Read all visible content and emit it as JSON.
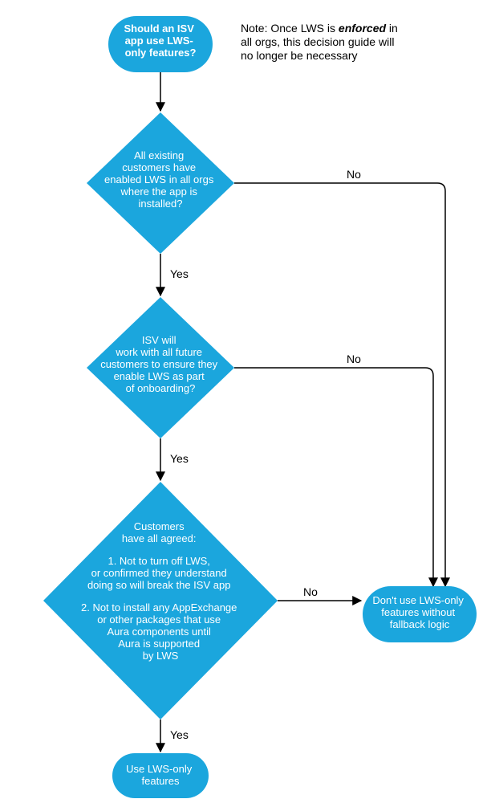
{
  "colors": {
    "shape": "#1ba6dd",
    "text_shape": "#ffffff",
    "text_note": "#000000",
    "edge": "#000000"
  },
  "start": {
    "text": "Should an ISV app use LWS-only features?"
  },
  "note": {
    "line1": "Note: Once LWS is",
    "emph": "enforced",
    "line1b": "in",
    "line2": "all orgs, this decision guide will",
    "line3": "no longer be necessary"
  },
  "decision1": {
    "text": "All existing customers have enabled LWS in all orgs where the app is installed?"
  },
  "decision2": {
    "text": "ISV will work with all future customers to ensure they enable LWS as part of onboarding?"
  },
  "decision3": {
    "header": "Customers have all agreed:",
    "item1": "1. Not to turn off LWS, or confirmed they understand doing so will break the ISV app",
    "item2": "2. Not to install any AppExchange or other packages that use Aura components until Aura is supported by LWS"
  },
  "result_yes": {
    "text": "Use LWS-only features"
  },
  "result_no": {
    "text": "Don't use LWS-only features without fallback logic"
  },
  "labels": {
    "yes": "Yes",
    "no": "No"
  }
}
